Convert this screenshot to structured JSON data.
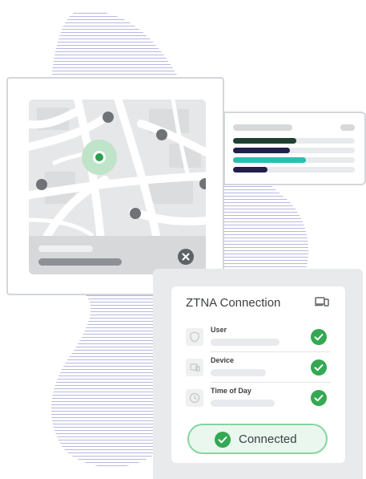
{
  "colors": {
    "accent_green": "#34a853",
    "map_pin_green": "#2e9e4f",
    "bar_dark_green": "#1e4133",
    "bar_navy": "#22204a",
    "bar_teal": "#2bbfb2",
    "placeholder_gray": "#d3d6da",
    "connected_bg": "#e9f7ee",
    "connected_border": "#86d4a0"
  },
  "map": {
    "pin_icon": "location-pin-icon",
    "close_icon": "close-icon"
  },
  "progress": {
    "bars": [
      {
        "fraction": 0.52
      },
      {
        "fraction": 0.47
      },
      {
        "fraction": 0.6
      },
      {
        "fraction": 0.28
      }
    ]
  },
  "ztna": {
    "title": "ZTNA Connection",
    "devices_icon": "devices-icon",
    "checks": [
      {
        "label": "User",
        "icon": "shield-icon",
        "status_icon": "check-circle-icon"
      },
      {
        "label": "Device",
        "icon": "device-icon",
        "status_icon": "check-circle-icon"
      },
      {
        "label": "Time of Day",
        "icon": "clock-icon",
        "status_icon": "check-circle-icon"
      }
    ],
    "connected_label": "Connected"
  }
}
